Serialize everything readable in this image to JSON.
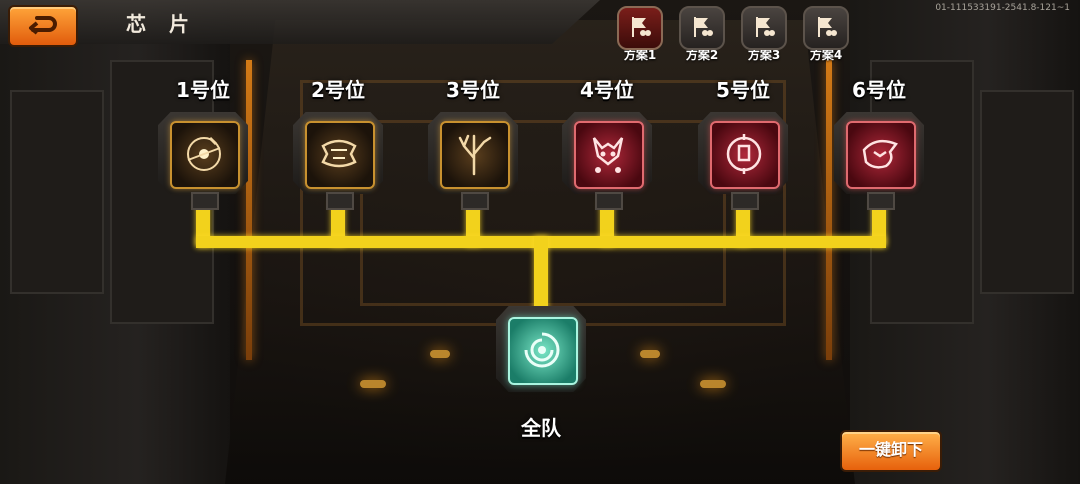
{
  "header": {
    "title": "芯 片",
    "version": "01-111533191-2541.8-121~1"
  },
  "plans": [
    {
      "label": "方案1",
      "active": true
    },
    {
      "label": "方案2",
      "active": false
    },
    {
      "label": "方案3",
      "active": false
    },
    {
      "label": "方案4",
      "active": false
    }
  ],
  "slots": [
    {
      "label": "1号位",
      "tier": "gold",
      "icon": "compass-chip-icon"
    },
    {
      "label": "2号位",
      "tier": "gold",
      "icon": "armor-chip-icon"
    },
    {
      "label": "3号位",
      "tier": "gold",
      "icon": "tree-chip-icon"
    },
    {
      "label": "4号位",
      "tier": "red",
      "icon": "demon-chip-icon"
    },
    {
      "label": "5号位",
      "tier": "red",
      "icon": "target-chip-icon"
    },
    {
      "label": "6号位",
      "tier": "red",
      "icon": "beast-chip-icon"
    }
  ],
  "team": {
    "label": "全队",
    "icon": "vortex-chip-icon"
  },
  "actions": {
    "unload_all": "一键卸下"
  },
  "colors": {
    "wire": "#f2d21c",
    "gold_frame": "#c8912f",
    "red_frame": "#e06a6f",
    "team_frame": "#a9f5e0",
    "button_orange": "#e7610c"
  }
}
